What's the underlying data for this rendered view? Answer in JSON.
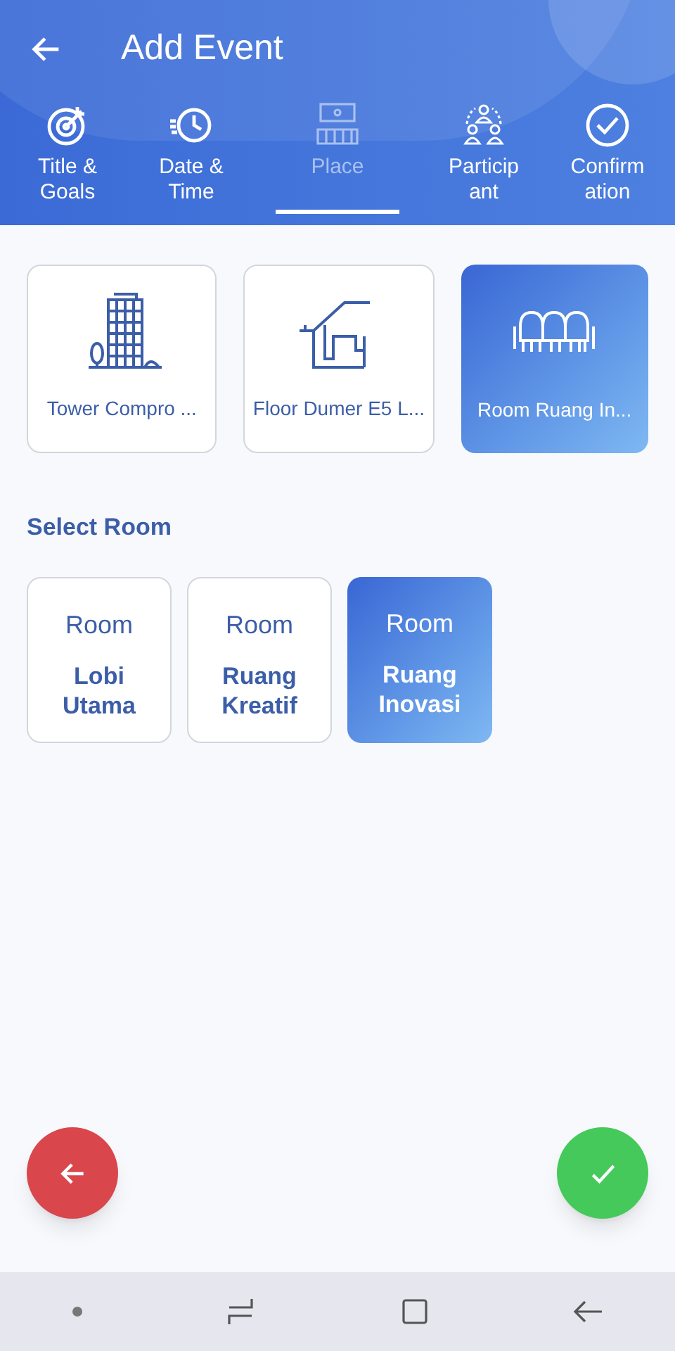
{
  "header": {
    "title": "Add Event"
  },
  "tabs": [
    {
      "label": "Title &\nGoals",
      "kind": "target",
      "selected": false
    },
    {
      "label": "Date &\nTime",
      "kind": "clock",
      "selected": false
    },
    {
      "label": "Place",
      "kind": "venue",
      "selected": true
    },
    {
      "label": "Particip\nant",
      "kind": "people",
      "selected": false
    },
    {
      "label": "Confirm\nation",
      "kind": "check",
      "selected": false
    }
  ],
  "places": [
    {
      "label": "Tower Compro ...",
      "kind": "building",
      "selected": false
    },
    {
      "label": "Floor Dumer E5 L...",
      "kind": "stairs",
      "selected": false
    },
    {
      "label": "Room Ruang In...",
      "kind": "chairs",
      "selected": true
    }
  ],
  "rooms_heading": "Select Room",
  "rooms": [
    {
      "title": "Room",
      "name": "Lobi Utama",
      "selected": false
    },
    {
      "title": "Room",
      "name": "Ruang Kreatif",
      "selected": false
    },
    {
      "title": "Room",
      "name": "Ruang Inovasi",
      "selected": true
    }
  ]
}
